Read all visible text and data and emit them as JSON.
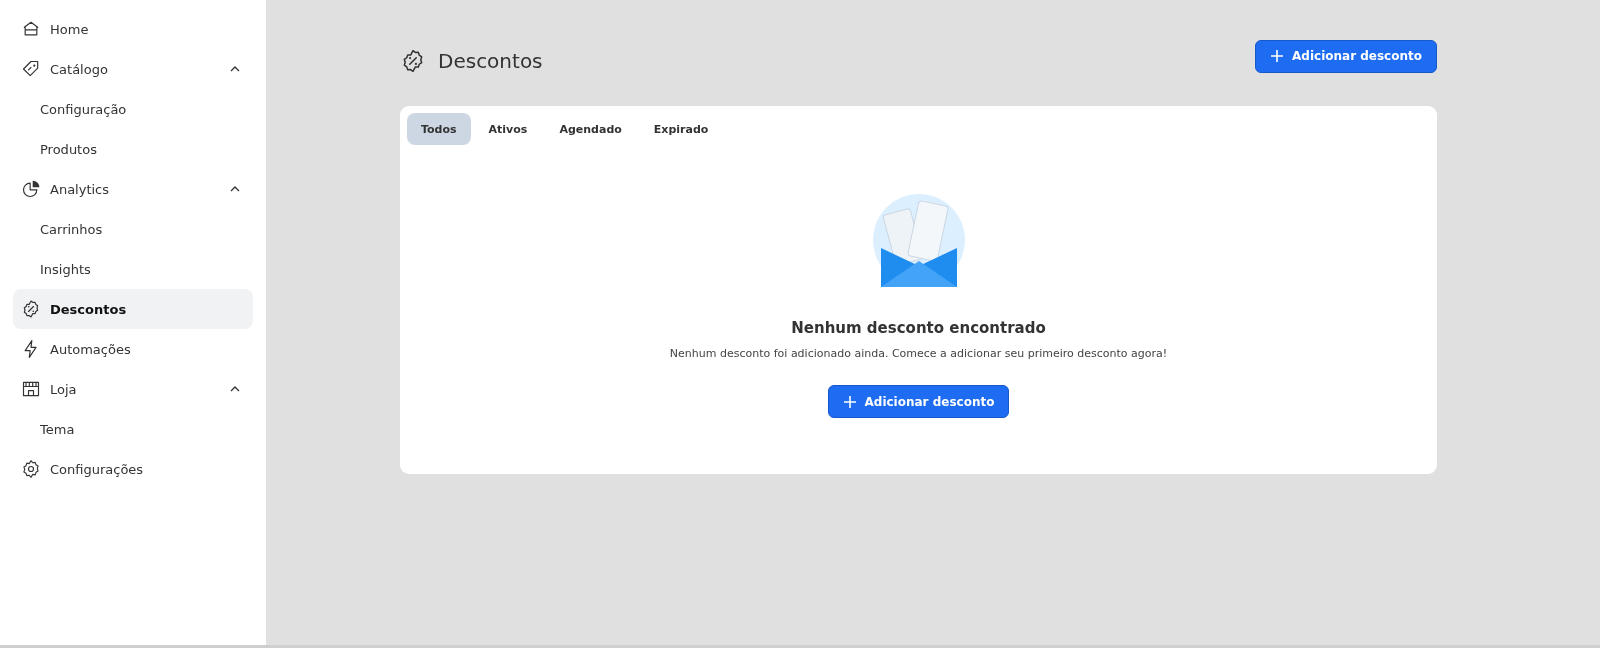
{
  "sidebar": {
    "items": [
      {
        "label": "Home",
        "selected": false
      },
      {
        "label": "Catálogo",
        "selected": false,
        "expanded": true,
        "children": [
          {
            "label": "Configuração",
            "selected": false
          },
          {
            "label": "Produtos",
            "selected": false
          }
        ]
      },
      {
        "label": "Analytics",
        "selected": false,
        "expanded": true,
        "children": [
          {
            "label": "Carrinhos",
            "selected": false
          },
          {
            "label": "Insights",
            "selected": false
          }
        ]
      },
      {
        "label": "Descontos",
        "selected": true
      },
      {
        "label": "Automações",
        "selected": false
      },
      {
        "label": "Loja",
        "selected": false,
        "expanded": true,
        "children": [
          {
            "label": "Tema",
            "selected": false
          }
        ]
      },
      {
        "label": "Configurações",
        "selected": false
      }
    ]
  },
  "page": {
    "title": "Descontos",
    "add_button": "Adicionar desconto"
  },
  "tabs": [
    {
      "label": "Todos",
      "selected": true
    },
    {
      "label": "Ativos",
      "selected": false
    },
    {
      "label": "Agendado",
      "selected": false
    },
    {
      "label": "Expirado",
      "selected": false
    }
  ],
  "empty_state": {
    "title": "Nenhum desconto encontrado",
    "message": "Nenhum desconto foi adicionado ainda. Comece a adicionar seu primeiro desconto agora!",
    "button": "Adicionar desconto"
  }
}
